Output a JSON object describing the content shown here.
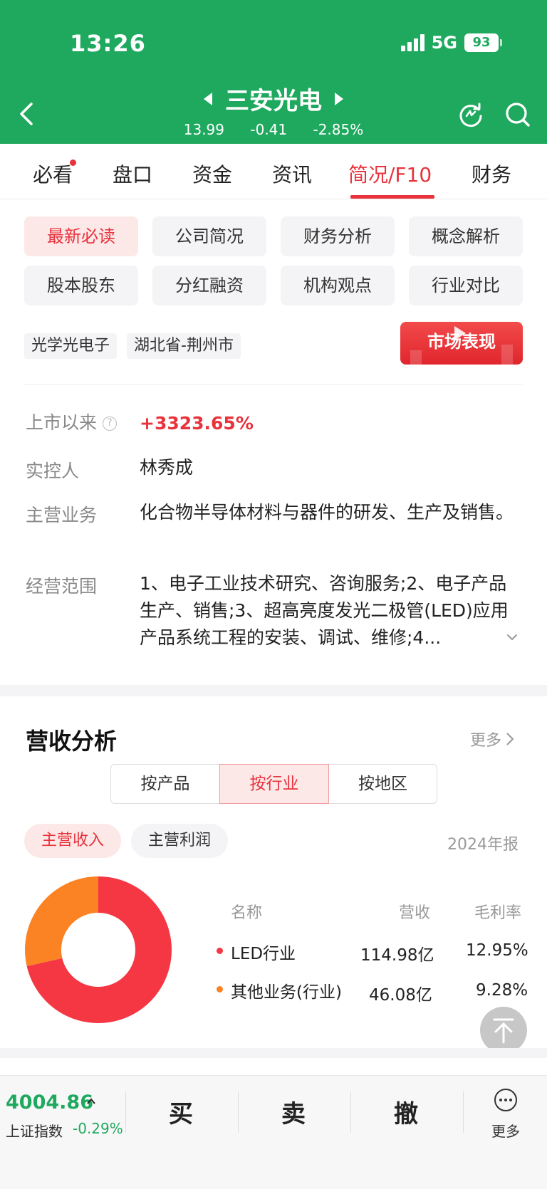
{
  "status": {
    "time": "13:26",
    "network": "5G",
    "battery": "93"
  },
  "stock": {
    "name": "三安光电",
    "price": "13.99",
    "change": "-0.41",
    "change_pct": "-2.85%"
  },
  "tabs": [
    {
      "label": "必看"
    },
    {
      "label": "盘口"
    },
    {
      "label": "资金"
    },
    {
      "label": "资讯"
    },
    {
      "label": "简况/F10"
    },
    {
      "label": "财务"
    }
  ],
  "sub_buttons": [
    {
      "label": "最新必读"
    },
    {
      "label": "公司简况"
    },
    {
      "label": "财务分析"
    },
    {
      "label": "概念解析"
    },
    {
      "label": "股本股东"
    },
    {
      "label": "分红融资"
    },
    {
      "label": "机构观点"
    },
    {
      "label": "行业对比"
    }
  ],
  "tags": [
    "光学光电子",
    "湖北省-荆州市"
  ],
  "market_banner": {
    "label": "市场表现"
  },
  "info": {
    "since_listing_label": "上市以来",
    "since_listing_value": "+3323.65%",
    "controller_label": "实控人",
    "controller_value": "林秀成",
    "main_business_label": "主营业务",
    "main_business_value": "化合物半导体材料与器件的研发、生产及销售。",
    "scope_label": "经营范围",
    "scope_value": "1、电子工业技术研究、咨询服务;2、电子产品生产、销售;3、超高亮度发光二极管(LED)应用产品系统工程的安装、调试、维修;4..."
  },
  "revenue": {
    "title": "营收分析",
    "more": "更多",
    "segments": [
      "按产品",
      "按行业",
      "按地区"
    ],
    "pills": [
      "主营收入",
      "主营利润"
    ],
    "report": "2024年报",
    "columns": {
      "name": "名称",
      "revenue": "营收",
      "margin": "毛利率"
    },
    "rows": [
      {
        "name": "LED行业",
        "revenue": "114.98亿",
        "margin": "12.95%"
      },
      {
        "name": "其他业务(行业)",
        "revenue": "46.08亿",
        "margin": "9.28%"
      }
    ]
  },
  "chart_data": {
    "type": "pie",
    "categories": [
      "LED行业",
      "其他业务(行业)"
    ],
    "values": [
      114.98,
      46.08
    ],
    "colors": [
      "#f53744",
      "#fb8323"
    ],
    "unit": "亿"
  },
  "bottom": {
    "index_value": "4004.86",
    "index_name": "上证指数",
    "index_change": "-0.29%",
    "buy": "买",
    "sell": "卖",
    "cancel": "撤",
    "more": "更多"
  },
  "colors": {
    "brand_green": "#1fa95f",
    "accent_red": "#e8323c"
  }
}
